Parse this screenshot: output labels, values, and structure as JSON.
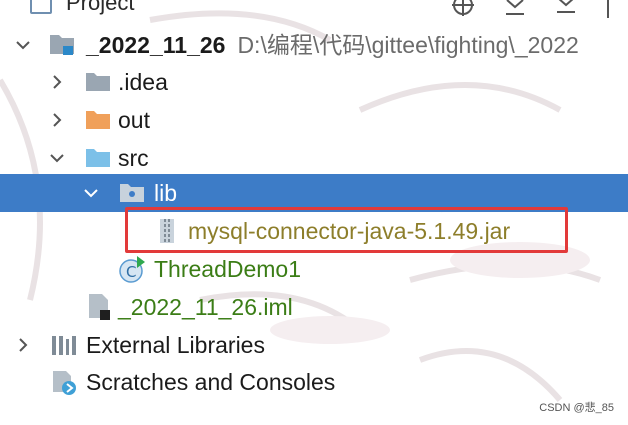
{
  "panel": {
    "title": "Project"
  },
  "tree": {
    "root": {
      "name": "_2022_11_26",
      "path": "D:\\编程\\代码\\gittee\\fighting\\_2022"
    },
    "items": [
      {
        "label": ".idea"
      },
      {
        "label": "out"
      },
      {
        "label": "src"
      },
      {
        "label": "lib"
      },
      {
        "label": "mysql-connector-java-5.1.49.jar"
      },
      {
        "label": "ThreadDemo1"
      },
      {
        "label": "_2022_11_26.iml"
      },
      {
        "label": "External Libraries"
      },
      {
        "label": "Scratches and Consoles"
      }
    ]
  },
  "watermark": "CSDN @悲_85",
  "colors": {
    "selection": "#3d7cc7",
    "highlight_border": "#e23a3a",
    "folder_grey": "#9aa6b2",
    "folder_orange": "#f0a05a",
    "folder_blue": "#7cc0e8",
    "class_green": "#3b7d16"
  },
  "icons": [
    "project-module-icon",
    "folder-icon",
    "folder-excluded-icon",
    "folder-source-icon",
    "jar-icon",
    "java-class-icon",
    "iml-file-icon",
    "library-icon",
    "scratches-icon"
  ]
}
